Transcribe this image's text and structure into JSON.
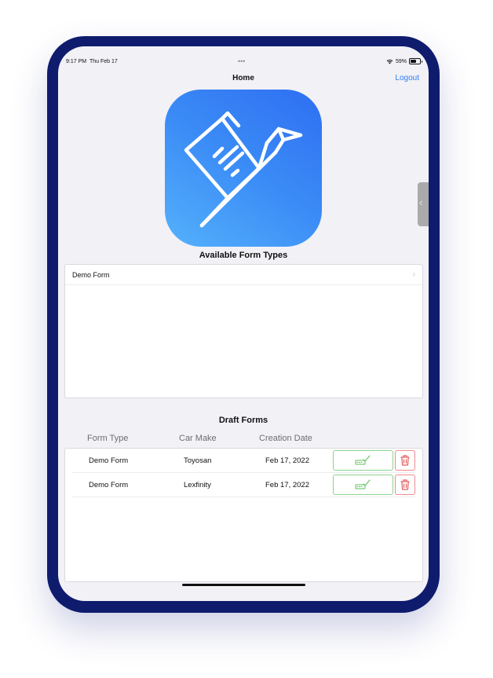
{
  "status_bar": {
    "time": "9:17 PM",
    "date": "Thu Feb 17",
    "battery": "59%"
  },
  "nav": {
    "title": "Home",
    "logout_label": "Logout"
  },
  "available_forms": {
    "title": "Available Form Types",
    "items": [
      {
        "label": "Demo Form"
      }
    ]
  },
  "drafts": {
    "title": "Draft Forms",
    "columns": [
      "Form Type",
      "Car Make",
      "Creation Date"
    ],
    "rows": [
      {
        "form_type": "Demo Form",
        "car_make": "Toyosan",
        "creation_date": "Feb 17, 2022"
      },
      {
        "form_type": "Demo Form",
        "car_make": "Lexfinity",
        "creation_date": "Feb 17, 2022"
      }
    ]
  },
  "icons": {
    "app_icon": "origami-bird-document-icon",
    "edit": "signature-edit-icon",
    "delete": "trash-icon",
    "chevron": "chevron-right-icon",
    "side_handle": "chevron-left-icon"
  },
  "colors": {
    "accent": "#2f7cf6",
    "device_frame": "#0f1c6e",
    "edit_green": "#8ed38f",
    "delete_red": "#f08b8b"
  }
}
